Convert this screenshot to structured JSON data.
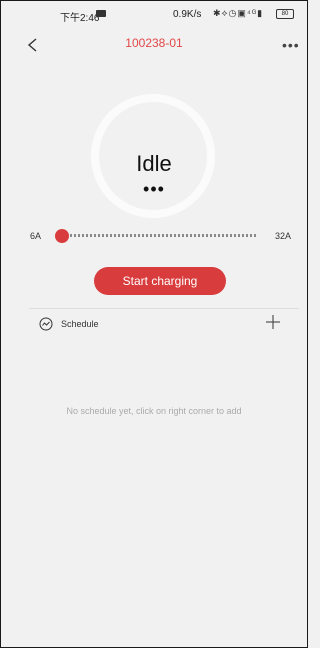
{
  "status_bar": {
    "time": "下午2:46",
    "network_speed": "0.9K/s",
    "icons": "✱⟡◷▣⁴ᴳ▮",
    "battery": "80"
  },
  "header": {
    "title": "100238-01",
    "back_icon": "chevron-left-icon",
    "more_icon": "more-dots-icon",
    "more_glyph": "•••"
  },
  "status": {
    "label": "Idle",
    "dots": "•••"
  },
  "current_slider": {
    "min_label": "6A",
    "max_label": "32A",
    "min": 6,
    "max": 32,
    "value": 6
  },
  "start_button": {
    "label": "Start charging"
  },
  "schedule": {
    "label": "Schedule",
    "icon": "trend-circle-icon",
    "add_icon": "plus-icon",
    "empty_text": "No schedule yet, click on right corner to add"
  },
  "colors": {
    "accent": "#d93c3c",
    "title": "#e14848",
    "background": "#f1f1f1"
  }
}
